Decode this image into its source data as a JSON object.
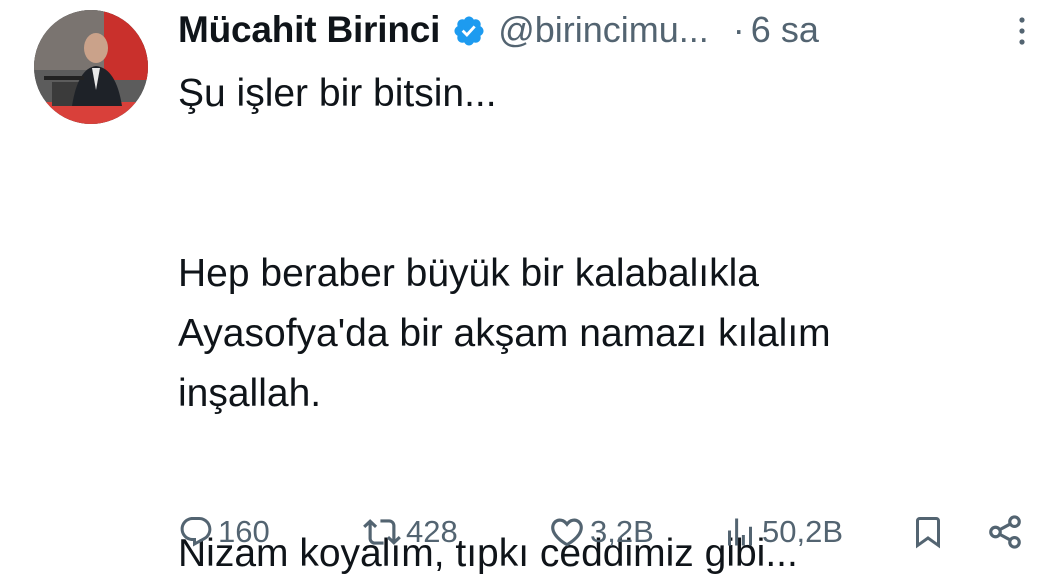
{
  "author": {
    "name": "Mücahit Birinci",
    "handle": "@birincimu...",
    "dot": "·",
    "time": "6 sa",
    "verified_color": "#1d9bf0"
  },
  "tweet": {
    "paragraphs": [
      [
        "Şu işler bir bitsin..."
      ],
      [
        "Hep beraber büyük bir kalabalıkla",
        "Ayasofya'da bir akşam namazı kılalım",
        "inşallah."
      ],
      [
        "Nizam koyalım, tıpkı ceddimiz gibi..."
      ]
    ]
  },
  "actions": {
    "reply_count": "160",
    "retweet_count": "428",
    "like_count": "3,2B",
    "view_count": "50,2B"
  },
  "icons": [
    "avatar",
    "verified-badge-icon",
    "more-icon",
    "reply-icon",
    "retweet-icon",
    "like-icon",
    "views-icon",
    "bookmark-icon",
    "share-icon"
  ]
}
